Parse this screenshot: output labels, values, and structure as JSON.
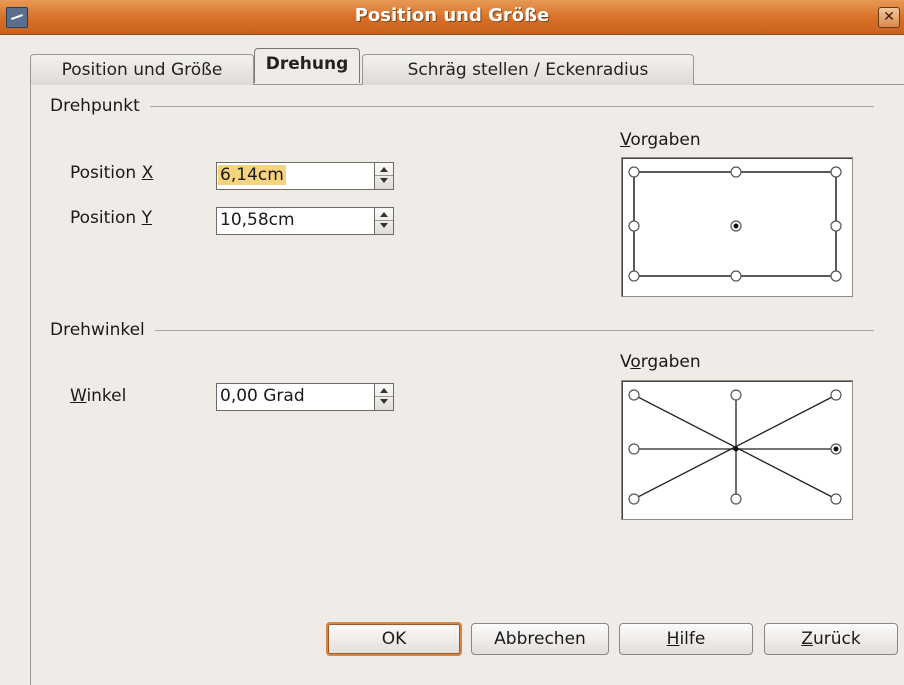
{
  "window": {
    "title": "Position und Größe",
    "close_glyph": "✕"
  },
  "tabs": [
    {
      "label": "Position und Größe",
      "active": false
    },
    {
      "label": "Drehung",
      "active": true
    },
    {
      "label": "Schräg stellen / Eckenradius",
      "active": false
    }
  ],
  "pivot": {
    "group_label": "Drehpunkt",
    "pos_x": {
      "label_pre": "Position ",
      "label_key": "X",
      "value": "6,14cm"
    },
    "pos_y": {
      "label_pre": "Position ",
      "label_key": "Y",
      "value": "10,58cm"
    },
    "presets": {
      "label_key": "V",
      "label_rest": "orgaben",
      "selected": "center"
    }
  },
  "angle": {
    "group_label": "Drehwinkel",
    "winkel": {
      "label_key": "W",
      "label_rest": "inkel",
      "value": "0,00 Grad"
    },
    "presets": {
      "label_pre": "V",
      "label_key": "o",
      "label_rest": "rgaben",
      "selected": "right"
    }
  },
  "buttons": {
    "ok": "OK",
    "cancel": "Abbrechen",
    "help_key": "H",
    "help_rest": "ilfe",
    "back_key": "Z",
    "back_rest": "urück"
  },
  "colors": {
    "title_bar": "#d8772e",
    "highlight": "#f6d37d",
    "default_button_border": "#d9853f"
  },
  "icons": [
    "app-icon",
    "close-icon",
    "spin-arrows-icon",
    "radio-icon"
  ]
}
